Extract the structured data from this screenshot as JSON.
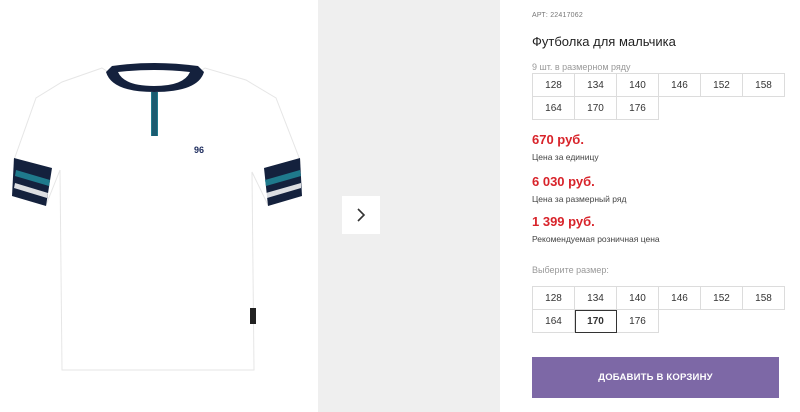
{
  "product": {
    "article_label": "АРТ:",
    "article_value": "22417062",
    "title": "Футболка для мальчика",
    "pack_note": "9 шт. в размерном ряду"
  },
  "size_row_sizes": [
    "128",
    "134",
    "140",
    "146",
    "152",
    "158",
    "164",
    "170",
    "176"
  ],
  "prices": {
    "unit_price": "670 руб.",
    "unit_label": "Цена за единицу",
    "row_price": "6 030 руб.",
    "row_label": "Цена за размерный ряд",
    "retail_price": "1 399 руб.",
    "retail_label": "Рекомендуемая розничная цена"
  },
  "size_select": {
    "label": "Выберите размер:",
    "sizes": [
      "128",
      "134",
      "140",
      "146",
      "152",
      "158",
      "164",
      "170",
      "176"
    ],
    "selected": "170"
  },
  "cart_button_label": "ДОБАВИТЬ В КОРЗИНУ",
  "gallery": {
    "shirt_logo": "96",
    "next_icon": "chevron-right-icon"
  }
}
